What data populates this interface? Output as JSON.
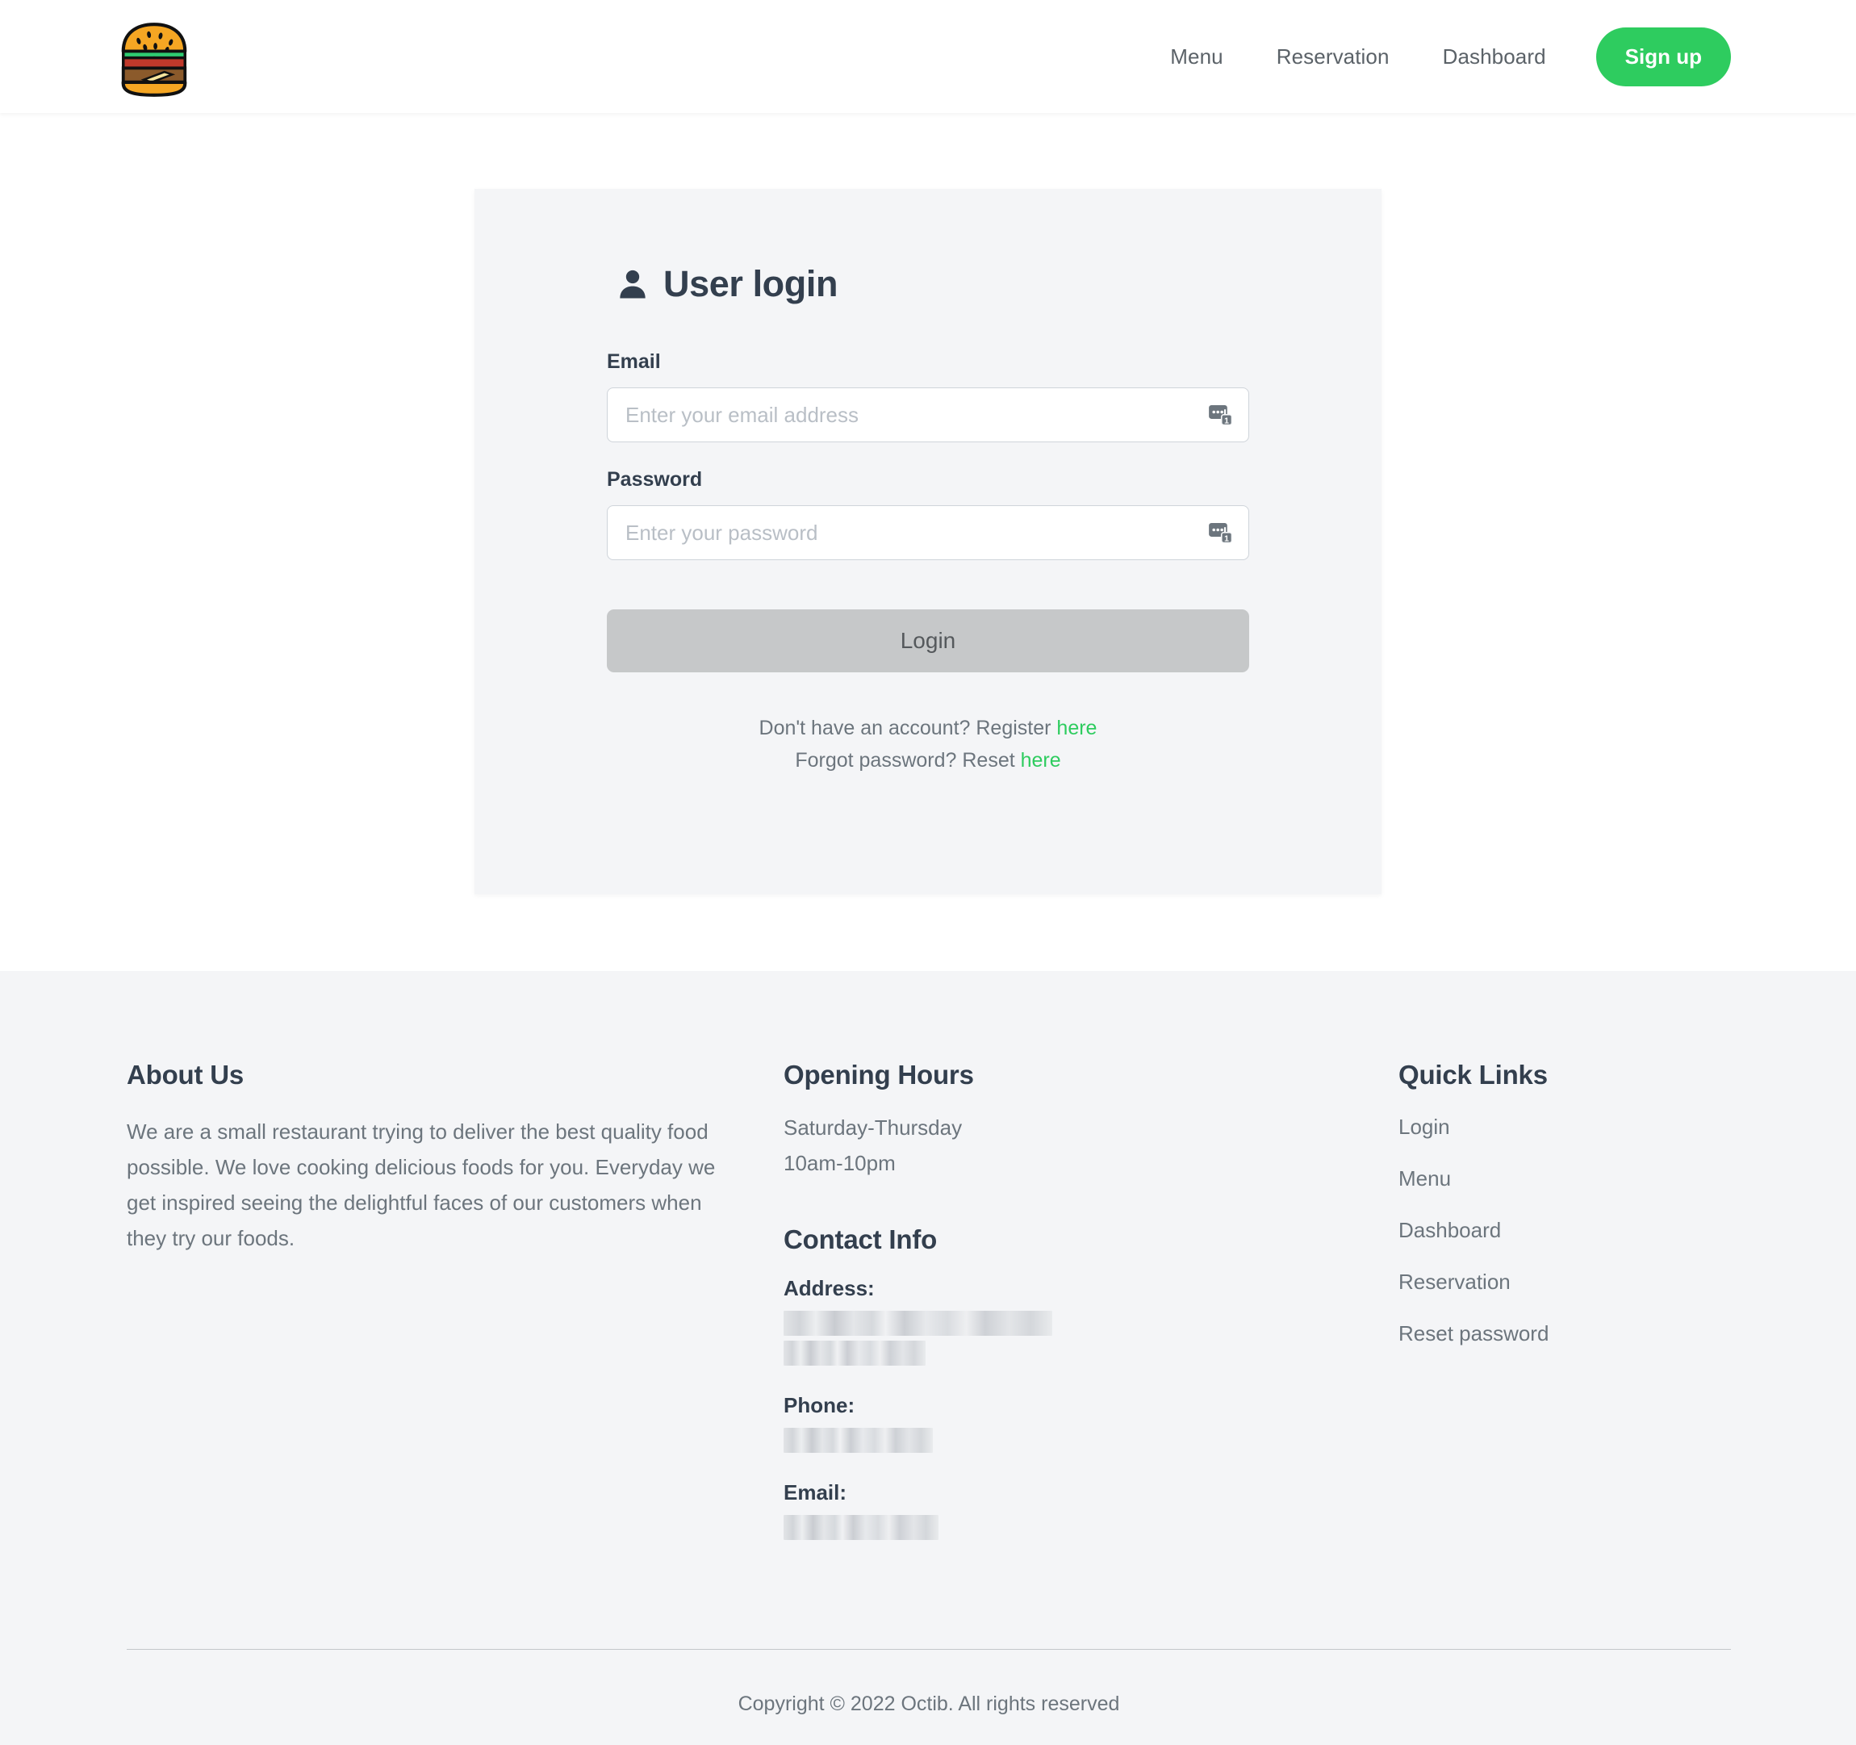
{
  "navbar": {
    "logo_icon": "burger-logo-icon",
    "links": [
      {
        "label": "Menu"
      },
      {
        "label": "Reservation"
      },
      {
        "label": "Dashboard"
      }
    ],
    "signup_label": "Sign up"
  },
  "login_card": {
    "title": "User login",
    "title_icon": "user-icon",
    "email": {
      "label": "Email",
      "placeholder": "Enter your email address",
      "value": "",
      "autofill_icon": "password-manager-icon",
      "autofill_badge": "1"
    },
    "password": {
      "label": "Password",
      "placeholder": "Enter your password",
      "value": "",
      "autofill_icon": "password-manager-icon",
      "autofill_badge": "1"
    },
    "submit_label": "Login",
    "register_prompt": "Don't have an account? Register ",
    "register_link": "here",
    "forgot_prompt": "Forgot password? Reset ",
    "forgot_link": "here"
  },
  "footer": {
    "about": {
      "heading": "About Us",
      "text": "We are a small restaurant trying to deliver the best quality food possible. We love cooking delicious foods for you. Everyday we get inspired seeing the delightful faces of our customers when they try our foods."
    },
    "hours": {
      "heading": "Opening Hours",
      "days": "Saturday-Thursday",
      "time": "10am-10pm"
    },
    "contact": {
      "heading": "Contact Info",
      "address_label": "Address:",
      "address_value": "",
      "phone_label": "Phone:",
      "phone_value": "",
      "email_label": "Email:",
      "email_value": ""
    },
    "quick_links": {
      "heading": "Quick Links",
      "items": [
        {
          "label": "Login"
        },
        {
          "label": "Menu"
        },
        {
          "label": "Dashboard"
        },
        {
          "label": "Reservation"
        },
        {
          "label": "Reset password"
        }
      ]
    },
    "copyright": "Copyright © 2022 Octib. All rights reserved"
  },
  "colors": {
    "accent_green": "#2ecc5f",
    "heading_dark": "#333f4e",
    "body_gray": "#6c757d",
    "panel_bg": "#f4f5f7",
    "disabled_button": "#c6c8c9"
  }
}
